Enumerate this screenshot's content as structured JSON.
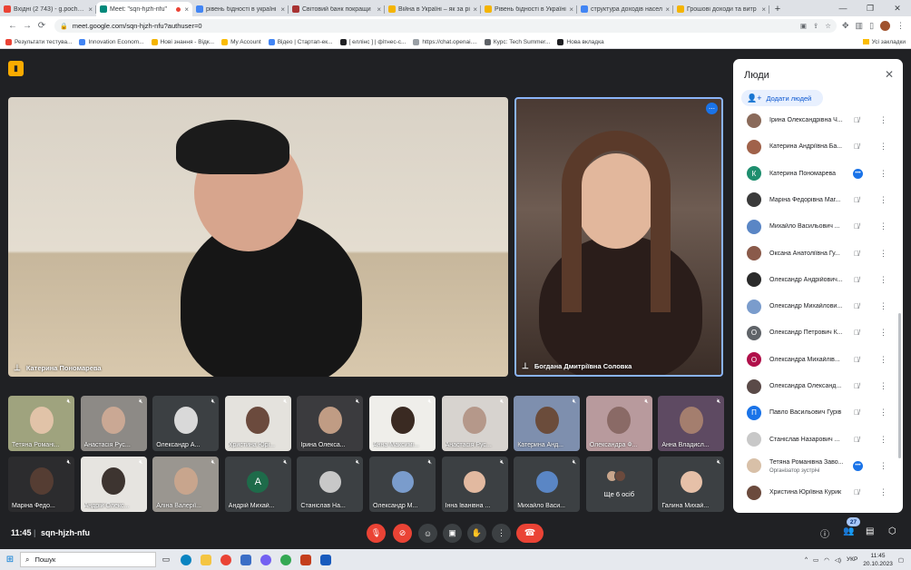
{
  "browser": {
    "tabs": [
      {
        "title": "Вхідні (2 743) - g.pocheru",
        "color": "#ea4335",
        "active": false
      },
      {
        "title": "Meet: \"sqn-hjzh-nfu\"",
        "color": "#00897b",
        "active": true,
        "recording": true
      },
      {
        "title": "рівень бідності в україні",
        "color": "#4285f4",
        "active": false
      },
      {
        "title": "Світовий банк покращи",
        "color": "#a83232",
        "active": false
      },
      {
        "title": "Війна в Україні – як за рі",
        "color": "#f4b400",
        "active": false
      },
      {
        "title": "Рівень бідності в Україні",
        "color": "#f4b400",
        "active": false
      },
      {
        "title": "структура доходів насел",
        "color": "#4285f4",
        "active": false
      },
      {
        "title": "Грошові доходи та витр",
        "color": "#f4b400",
        "active": false
      }
    ],
    "url": "meet.google.com/sqn-hjzh-nfu?authuser=0",
    "bookmarks": [
      {
        "label": "Результати тестува...",
        "color": "#ea4335"
      },
      {
        "label": "Innovation Econom...",
        "color": "#4285f4"
      },
      {
        "label": "Нові знання - Відк...",
        "color": "#f4b400"
      },
      {
        "label": "My Account",
        "color": "#fbbc04"
      },
      {
        "label": "Відео | Стартап-ек...",
        "color": "#4285f4"
      },
      {
        "label": "[ еллінс ] | фітнес-с...",
        "color": "#202124"
      },
      {
        "label": "https://chat.openai....",
        "color": "#9aa0a6"
      },
      {
        "label": "Курс: Tech Summer...",
        "color": "#5f6368"
      },
      {
        "label": "Нова вкладка",
        "color": "#202124"
      }
    ],
    "all_bookmarks": "Усі закладки"
  },
  "meet": {
    "main_tiles": [
      {
        "name": "Катерина Пономарева"
      },
      {
        "name": "Богдана Дмитріївна Соловка"
      }
    ],
    "thumbs": [
      {
        "name": "Тетяна Романі...",
        "type": "video",
        "bg": "#9fa37e",
        "face": "#e1c3a8"
      },
      {
        "name": "Анастасія Рус...",
        "type": "video",
        "bg": "#8d8a86",
        "face": "#caa894"
      },
      {
        "name": "Олександр А...",
        "type": "video",
        "bg": "#3c4043",
        "face": "#d9d9d9"
      },
      {
        "name": "Христина Юрі...",
        "type": "video",
        "bg": "#e4e2dd",
        "face": "#6b4a3d"
      },
      {
        "name": "Ірина Олекса...",
        "type": "video",
        "bg": "#3b3b3e",
        "face": "#c09c84"
      },
      {
        "name": "Анна Максимі...",
        "type": "video",
        "bg": "#efeeea",
        "face": "#3a2a22"
      },
      {
        "name": "Анастасія Рус...",
        "type": "video",
        "bg": "#d7d3cf",
        "face": "#b5988a"
      },
      {
        "name": "Катерина Анд...",
        "type": "video",
        "bg": "#7e8fae",
        "face": "#6b4c3b"
      },
      {
        "name": "Олександра Ф...",
        "type": "video",
        "bg": "#b89a9d",
        "face": "#8a6a66"
      },
      {
        "name": "Анна Владисл...",
        "type": "video",
        "bg": "#5e4a62",
        "face": "#a47e6e"
      },
      {
        "name": "Маріна Федо...",
        "type": "video",
        "bg": "#2c2c2e",
        "face": "#553d33"
      },
      {
        "name": "Андрій Олекс...",
        "type": "video",
        "bg": "#e6e4e0",
        "face": "#3d3430"
      },
      {
        "name": "Аліна Валерії...",
        "type": "video",
        "bg": "#9a9690",
        "face": "#c8a58d"
      },
      {
        "name": "Андрій Михай...",
        "type": "avatar",
        "letter": "А",
        "avcolor": "#1e6b4a"
      },
      {
        "name": "Станіслав На...",
        "type": "avatar",
        "letter": "",
        "avcolor": "#c8c8c8"
      },
      {
        "name": "Олександр М...",
        "type": "avatar",
        "letter": "",
        "avcolor": "#7a9ccc"
      },
      {
        "name": "Інна Іванівна ...",
        "type": "avatar",
        "letter": "",
        "avcolor": "#e2b9a0"
      },
      {
        "name": "Михайло Васи...",
        "type": "avatar",
        "letter": "",
        "avcolor": "#5a86c5"
      },
      {
        "name": "Ще 6 осіб",
        "type": "more"
      },
      {
        "name": "Галина Михай...",
        "type": "avatar",
        "letter": "",
        "avcolor": "#e6c0a8"
      }
    ],
    "time": "11:45",
    "meeting_code": "sqn-hjzh-nfu",
    "participant_count": "27"
  },
  "people_panel": {
    "title": "Люди",
    "add_label": "Додати людей",
    "participants": [
      {
        "name": "Ірина Олександрівна Ч...",
        "letter": "",
        "color": "#8a6a5a",
        "mic": "muted"
      },
      {
        "name": "Катерина Андріївна Ба...",
        "letter": "",
        "color": "#a0624a",
        "mic": "muted"
      },
      {
        "name": "Катерина Пономарева",
        "letter": "К",
        "color": "#1e8e6e",
        "mic": "speaking"
      },
      {
        "name": "Маріна Федорівна Маг...",
        "letter": "",
        "color": "#3a3a3a",
        "mic": "muted"
      },
      {
        "name": "Михайло Васильович ...",
        "letter": "",
        "color": "#5a86c5",
        "mic": "muted"
      },
      {
        "name": "Оксана Анатоліївна Гу...",
        "letter": "",
        "color": "#8a5a4a",
        "mic": "muted"
      },
      {
        "name": "Олександр Андрійович...",
        "letter": "",
        "color": "#2a2a2a",
        "mic": "muted"
      },
      {
        "name": "Олександр Михайлови...",
        "letter": "",
        "color": "#7a9ccc",
        "mic": "muted"
      },
      {
        "name": "Олександр Петрович К...",
        "letter": "О",
        "color": "#5f6368",
        "mic": "muted"
      },
      {
        "name": "Олександра Михайлів...",
        "letter": "О",
        "color": "#b0104a",
        "mic": "muted"
      },
      {
        "name": "Олександра Олександ...",
        "letter": "",
        "color": "#5a4a48",
        "mic": "muted"
      },
      {
        "name": "Павло Васильович Гурів",
        "letter": "П",
        "color": "#1a73e8",
        "mic": "muted"
      },
      {
        "name": "Станіслав Назарович ...",
        "letter": "",
        "color": "#c8c8c8",
        "mic": "muted"
      },
      {
        "name": "Тетяна Романівна Заво...",
        "letter": "",
        "color": "#d8c0a8",
        "mic": "speaking",
        "sub": "Організатор зустрічі"
      },
      {
        "name": "Христина Юріївна Курик",
        "letter": "",
        "color": "#6b4a3d",
        "mic": "muted"
      }
    ]
  },
  "taskbar": {
    "search_placeholder": "Пошук",
    "language": "УКР",
    "time": "11:45",
    "date": "20.10.2023"
  }
}
